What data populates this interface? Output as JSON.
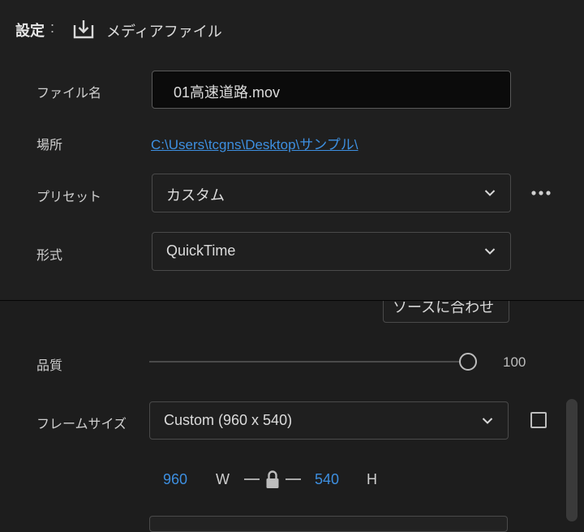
{
  "header": {
    "title": "設定",
    "colon": ":",
    "icon": "download-icon",
    "subtitle": "メディアファイル"
  },
  "fields": {
    "file_name": {
      "label": "ファイル名",
      "value": "01高速道路.mov"
    },
    "location": {
      "label": "場所",
      "value": "C:\\Users\\tcgns\\Desktop\\サンプル\\"
    },
    "preset": {
      "label": "プリセット",
      "value": "カスタム",
      "more_icon": "more-horizontal-icon"
    },
    "format": {
      "label": "形式",
      "value": "QuickTime"
    }
  },
  "partial_button": {
    "label": "ソースに合わせる"
  },
  "quality": {
    "label": "品質",
    "value": 100,
    "value_text": "100"
  },
  "frame_size": {
    "label": "フレームサイズ",
    "value": "Custom (960 x 540)",
    "width": "960",
    "width_unit": "W",
    "height": "540",
    "height_unit": "H",
    "lock_icon": "lock-icon"
  },
  "colors": {
    "background": "#1d1d1d",
    "accent": "#3d8fe0",
    "text": "#d6d6d6",
    "border": "#4a4a4a"
  }
}
